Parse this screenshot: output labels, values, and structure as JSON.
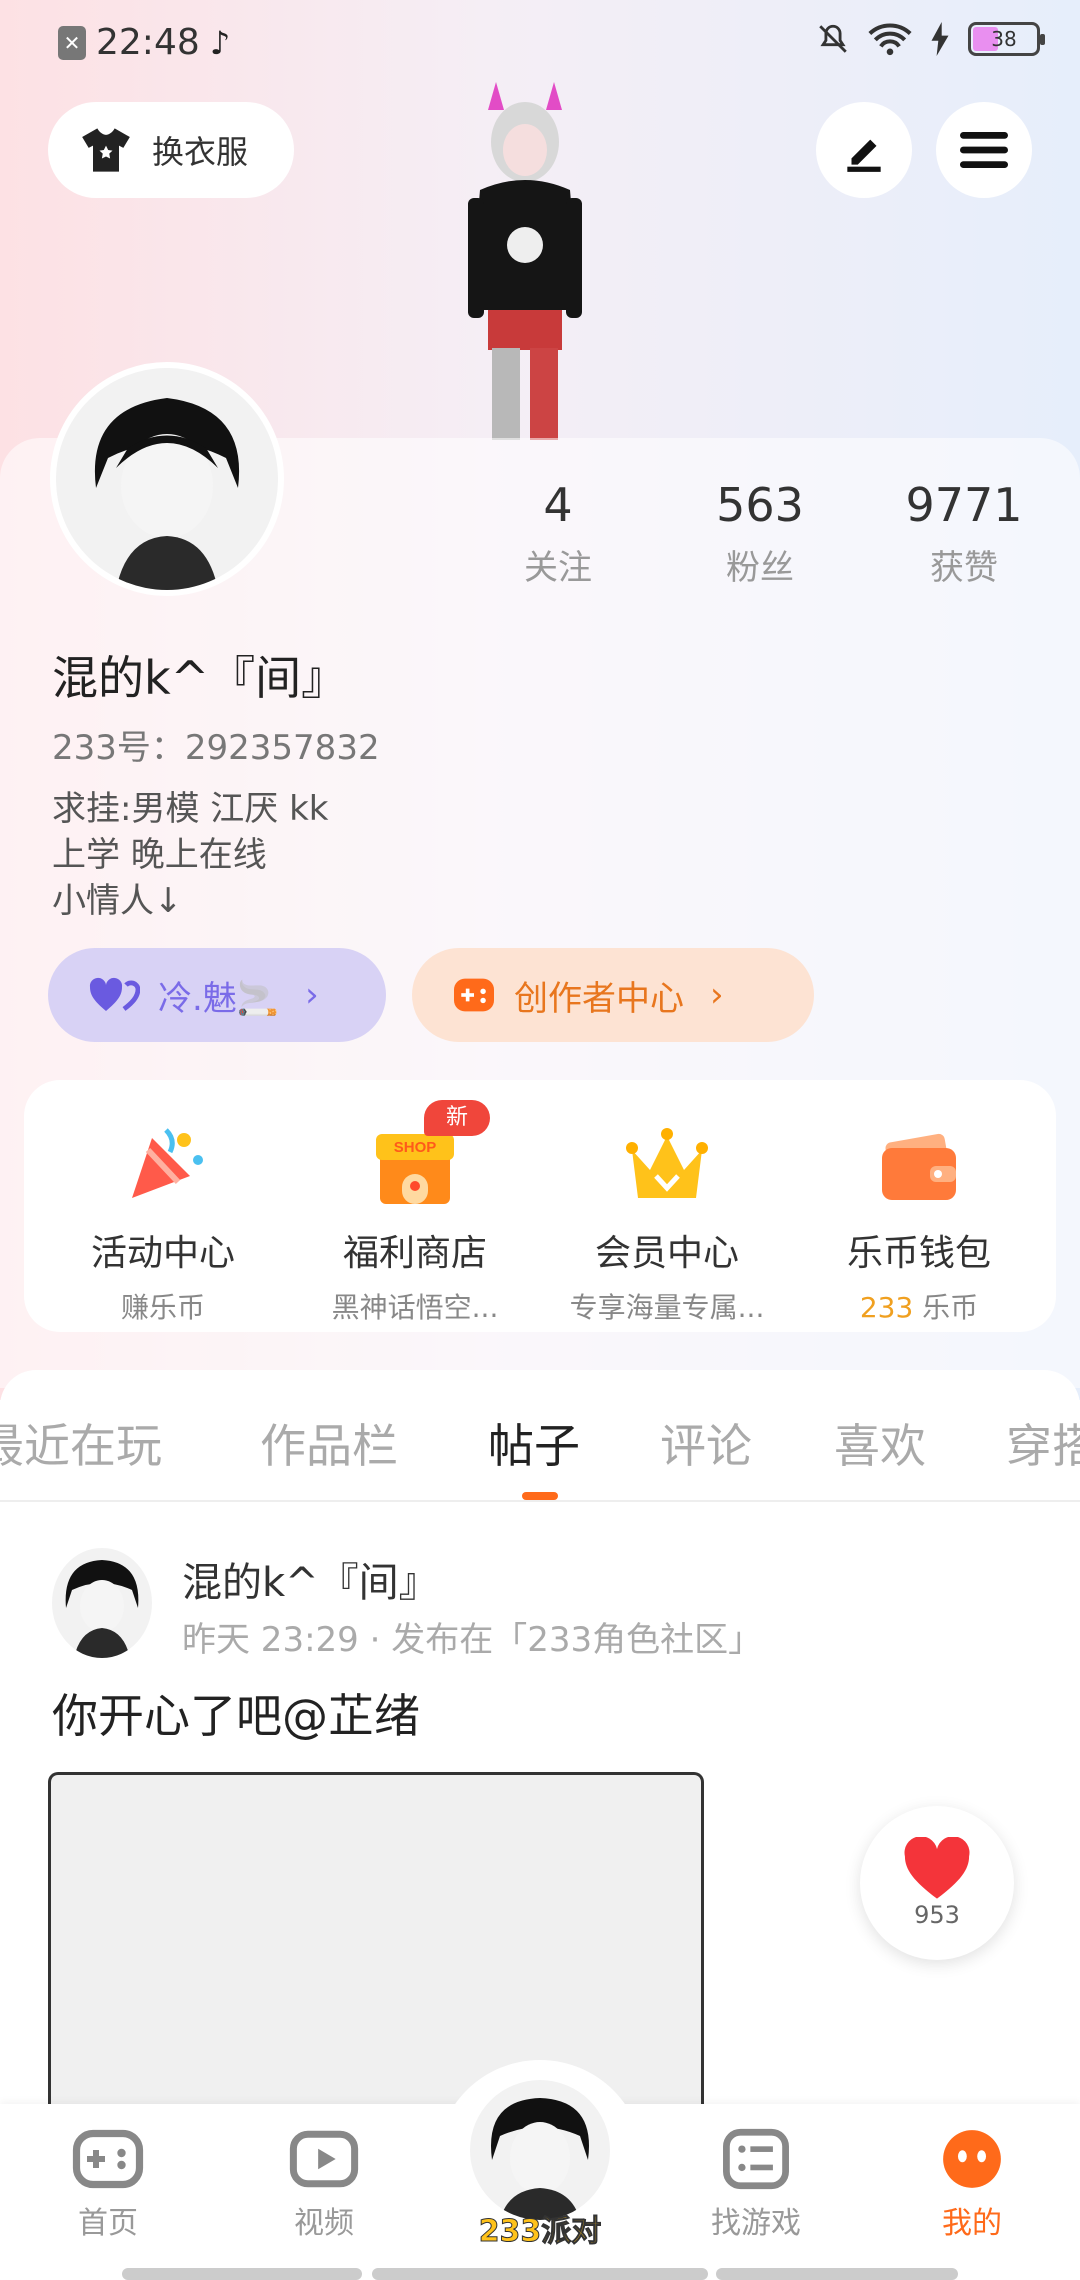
{
  "status_bar": {
    "time": "22:48",
    "battery": "38"
  },
  "header": {
    "dress_button": "换衣服"
  },
  "profile": {
    "nickname": "混的k^『间』",
    "uid": "233号：292357832",
    "bio": [
      "求挂:男模 江厌 kk",
      "上学 晚上在线",
      "小情人↓"
    ],
    "stats": [
      {
        "value": "4",
        "label": "关注"
      },
      {
        "value": "563",
        "label": "粉丝"
      },
      {
        "value": "9771",
        "label": "获赞"
      }
    ],
    "pills": {
      "purple": "冷.魅🚬",
      "orange": "创作者中心"
    }
  },
  "features": [
    {
      "title": "活动中心",
      "subtitle": "赚乐币"
    },
    {
      "title": "福利商店",
      "subtitle": "黑神话悟空..."
    },
    {
      "title": "会员中心",
      "subtitle": "专享海量专属..."
    },
    {
      "title": "乐币钱包",
      "subtitle_num": "233",
      "subtitle": "乐币"
    }
  ],
  "new_badge": "新",
  "tabs": [
    "最近在玩",
    "作品栏",
    "帖子",
    "评论",
    "喜欢",
    "穿搭"
  ],
  "post": {
    "author": "混的k^『间』",
    "meta": "昨天 23:29 · 发布在「233角色社区」",
    "text": "你开心了吧@芷绪",
    "likes": "953"
  },
  "bottom_nav": {
    "items": [
      "首页",
      "视频",
      "找游戏",
      "我的"
    ],
    "center": "233派对"
  },
  "colors": {
    "accent": "#ff6a1a",
    "purple": "#7a6be8",
    "gold": "#ffc21a"
  }
}
